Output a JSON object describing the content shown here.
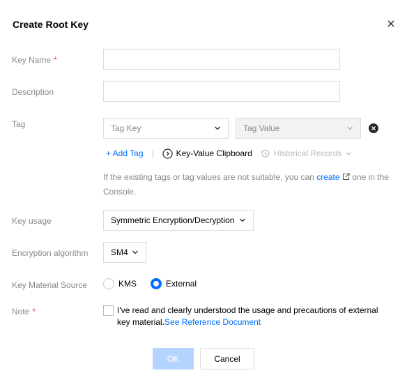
{
  "dialog": {
    "title": "Create Root Key",
    "close_icon": "close-icon"
  },
  "fields": {
    "key_name": {
      "label": "Key Name",
      "required": "*",
      "value": ""
    },
    "description": {
      "label": "Description",
      "value": ""
    },
    "tag": {
      "label": "Tag",
      "key_placeholder": "Tag Key",
      "value_placeholder": "Tag Value",
      "add_tag": "+ Add Tag",
      "separator": "|",
      "clipboard": "Key-Value Clipboard",
      "history": "Historical Records",
      "hint_before": "If the existing tags or tag values are not suitable, you can ",
      "hint_link": "create",
      "hint_after": " one in the Console."
    },
    "key_usage": {
      "label": "Key usage",
      "value": "Symmetric Encryption/Decryption"
    },
    "algorithm": {
      "label": "Encryption algorithm",
      "value": "SM4"
    },
    "material_source": {
      "label": "Key Material Source",
      "options": [
        "KMS",
        "External"
      ],
      "selected": "External"
    },
    "note": {
      "label": "Note",
      "required": "*",
      "text": "I've read and clearly understood the usage and precautions of external key material.",
      "link": "See Reference Document"
    }
  },
  "buttons": {
    "ok": "OK",
    "cancel": "Cancel"
  },
  "colors": {
    "accent": "#006eff",
    "required": "#e54545",
    "ok_disabled": "#b3d4ff"
  }
}
